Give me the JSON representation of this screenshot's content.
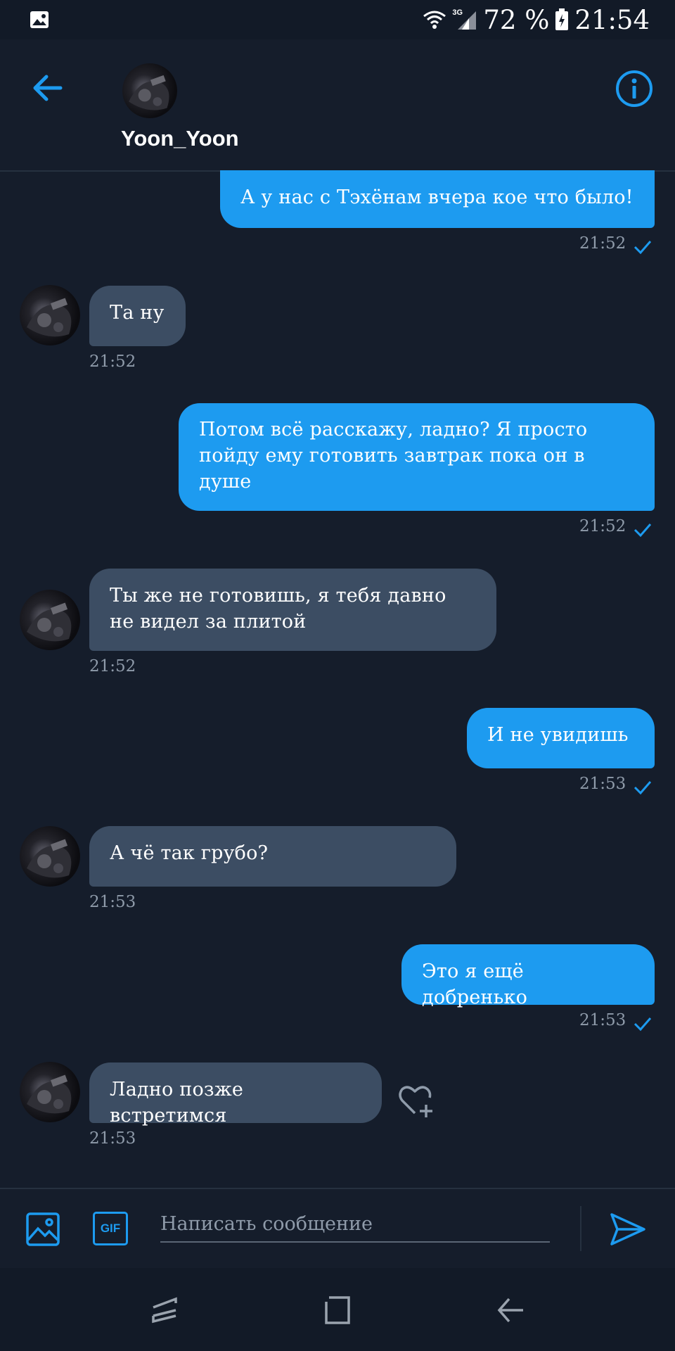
{
  "status_bar": {
    "network": "3G",
    "battery": "72 %",
    "clock": "21:54"
  },
  "header": {
    "contact_name": "Yoon_Yoon",
    "back_icon": "arrow-left-icon",
    "info_icon": "info-icon"
  },
  "colors": {
    "accent": "#1d9bf0",
    "background": "#151d2b",
    "incoming_bubble": "#3c4d63"
  },
  "messages": [
    {
      "direction": "out",
      "text": "А у нас с Тэхёнам вчера кое что было!",
      "time": "21:52"
    },
    {
      "direction": "in",
      "text": "Та ну",
      "time": "21:52"
    },
    {
      "direction": "out",
      "lines": [
        "Потом всё расскажу, ладно? Я просто",
        "пойду ему готовить завтрак пока он в",
        "душе"
      ],
      "time": "21:52"
    },
    {
      "direction": "in",
      "lines": [
        "Ты же не готовишь, я тебя давно",
        "не видел за плитой"
      ],
      "time": "21:52"
    },
    {
      "direction": "out",
      "text": "И не увидишь",
      "time": "21:53"
    },
    {
      "direction": "in",
      "text": "А чё так грубо?",
      "time": "21:53"
    },
    {
      "direction": "out",
      "text": "Это я ещё добренько",
      "time": "21:53"
    },
    {
      "direction": "in",
      "text": "Ладно позже встретимся",
      "time": "21:53"
    }
  ],
  "composer": {
    "placeholder": "Написать сообщение",
    "gif_label": "GIF"
  }
}
